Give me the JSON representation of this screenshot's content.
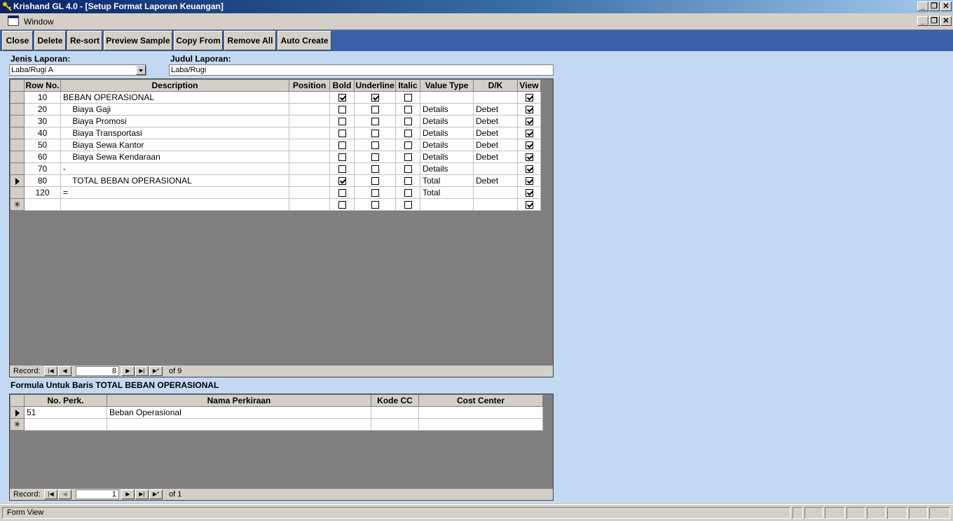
{
  "window": {
    "title": "Krishand GL 4.0 - [Setup Format Laporan Keuangan]",
    "minimize": "_",
    "restore": "❐",
    "close": "✕"
  },
  "menu": {
    "window_label": "Window"
  },
  "toolbar": {
    "close": "Close",
    "delete": "Delete",
    "resort": "Re-sort",
    "preview": "Preview Sample",
    "copy_from": "Copy From",
    "remove_all": "Remove All",
    "auto_create": "Auto Create"
  },
  "form": {
    "jenis_label": "Jenis Laporan:",
    "jenis_value": "Laba/Rugi A",
    "judul_label": "Judul Laporan:",
    "judul_value": "Laba/Rugi"
  },
  "main_grid": {
    "columns": [
      "Row No.",
      "Description",
      "Position",
      "Bold",
      "Underline",
      "Italic",
      "Value Type",
      "D/K",
      "View"
    ],
    "rows": [
      {
        "row_no": "10",
        "desc": "BEBAN OPERASIONAL",
        "position": "",
        "bold": true,
        "underline": true,
        "italic": false,
        "value_type": "",
        "dk": "",
        "view": true,
        "current": false
      },
      {
        "row_no": "20",
        "desc": "    Biaya Gaji",
        "position": "",
        "bold": false,
        "underline": false,
        "italic": false,
        "value_type": "Details",
        "dk": "Debet",
        "view": true,
        "current": false
      },
      {
        "row_no": "30",
        "desc": "    Biaya Promosi",
        "position": "",
        "bold": false,
        "underline": false,
        "italic": false,
        "value_type": "Details",
        "dk": "Debet",
        "view": true,
        "current": false
      },
      {
        "row_no": "40",
        "desc": "    Biaya Transportasi",
        "position": "",
        "bold": false,
        "underline": false,
        "italic": false,
        "value_type": "Details",
        "dk": "Debet",
        "view": true,
        "current": false
      },
      {
        "row_no": "50",
        "desc": "    Biaya Sewa Kantor",
        "position": "",
        "bold": false,
        "underline": false,
        "italic": false,
        "value_type": "Details",
        "dk": "Debet",
        "view": true,
        "current": false
      },
      {
        "row_no": "60",
        "desc": "    Biaya Sewa Kendaraan",
        "position": "",
        "bold": false,
        "underline": false,
        "italic": false,
        "value_type": "Details",
        "dk": "Debet",
        "view": true,
        "current": false
      },
      {
        "row_no": "70",
        "desc": "-",
        "position": "",
        "bold": false,
        "underline": false,
        "italic": false,
        "value_type": "Details",
        "dk": "",
        "view": true,
        "current": false
      },
      {
        "row_no": "80",
        "desc": "    TOTAL BEBAN OPERASIONAL",
        "position": "",
        "bold": true,
        "underline": false,
        "italic": false,
        "value_type": "Total",
        "dk": "Debet",
        "view": true,
        "current": true
      },
      {
        "row_no": "120",
        "desc": "=",
        "position": "",
        "bold": false,
        "underline": false,
        "italic": false,
        "value_type": "Total",
        "dk": "",
        "view": true,
        "current": false
      }
    ],
    "new_row_view": true,
    "nav": {
      "label": "Record:",
      "current": "8",
      "of": "of  9"
    }
  },
  "formula": {
    "title": "Formula Untuk Baris TOTAL BEBAN OPERASIONAL",
    "columns": [
      "No. Perk.",
      "Nama Perkiraan",
      "Kode CC",
      "Cost Center"
    ],
    "rows": [
      {
        "no_perk": "51",
        "nama": "Beban Operasional",
        "kode_cc": "",
        "cost_center": ""
      }
    ],
    "nav": {
      "label": "Record:",
      "current": "1",
      "of": "of  1"
    }
  },
  "status": {
    "text": "Form View"
  },
  "icons": {
    "first": "first-record-icon",
    "prev": "prev-record-icon",
    "next": "next-record-icon",
    "last": "last-record-icon",
    "new": "new-record-icon"
  }
}
